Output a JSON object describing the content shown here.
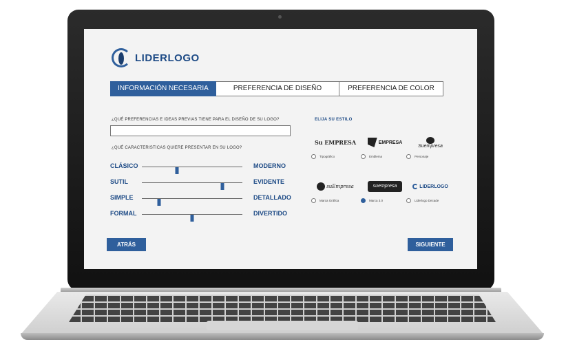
{
  "brand": {
    "name": "LIDERLOGO"
  },
  "tabs": [
    {
      "label": "INFORMACIÓN NECESARIA",
      "active": true
    },
    {
      "label": "PREFERENCIA DE DISEÑO",
      "active": false
    },
    {
      "label": "PREFERENCIA DE COLOR",
      "active": false
    }
  ],
  "questions": {
    "ideas": "¿QUÉ PREFERENCIAS E IDEAS PREVIAS TIENE PARA EL DISEÑO DE SU LOGO?",
    "ideas_value": "",
    "characteristics": "¿QUÉ CARACTERISTICAS QUIERE PRESENTAR EN SU LOGO?"
  },
  "sliders": [
    {
      "left": "CLÁSICO",
      "right": "MODERNO",
      "value": 0.35
    },
    {
      "left": "SUTIL",
      "right": "EVIDENTE",
      "value": 0.8
    },
    {
      "left": "SIMPLE",
      "right": "DETALLADO",
      "value": 0.17
    },
    {
      "left": "FORMAL",
      "right": "DIVERTIDO",
      "value": 0.5
    }
  ],
  "styles": {
    "title": "ELIJA SU ESTILO",
    "options": [
      {
        "label": "Tipográfico",
        "sample": "Su EMPRESA",
        "selected": false
      },
      {
        "label": "Emblema",
        "sample": "EMPRESA",
        "selected": false
      },
      {
        "label": "Personaje",
        "sample": "Suempresa",
        "selected": false
      },
      {
        "label": "Marca Gráfica",
        "sample": "suEmpresa",
        "selected": false
      },
      {
        "label": "Marca 3.0",
        "sample": "suempresa",
        "selected": true
      },
      {
        "label": "Liderlogo Decade",
        "sample": "LIDERLOGO",
        "selected": false
      }
    ]
  },
  "buttons": {
    "back": "ATRÁS",
    "next": "SIGUIENTE"
  },
  "colors": {
    "accent": "#2f5f9c",
    "brand_text": "#1e4b86"
  }
}
